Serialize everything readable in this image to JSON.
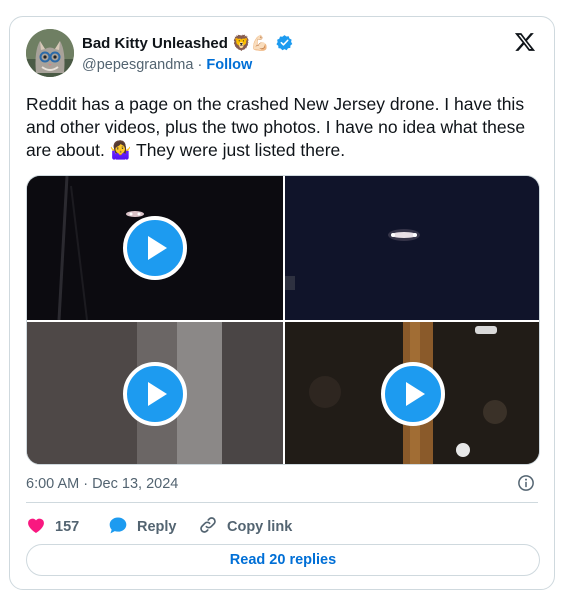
{
  "tweet": {
    "author_name": "Bad Kitty Unleashed",
    "author_emoji": "🦁💪🏻",
    "handle": "@pepesgrandma",
    "separator": " · ",
    "follow_label": "Follow",
    "text": "Reddit has a page on the crashed New Jersey drone. I have this and other videos, plus the two photos. I have no idea what these are about. 🤷‍♀️ They were just listed there.",
    "timestamp": "6:00 AM · Dec 13, 2024"
  },
  "actions": {
    "like_count": "157",
    "reply_label": "Reply",
    "copy_link_label": "Copy link"
  },
  "read_replies_label": "Read 20 replies",
  "media": [
    {
      "kind": "video"
    },
    {
      "kind": "video"
    },
    {
      "kind": "video"
    },
    {
      "kind": "video"
    }
  ],
  "colors": {
    "accent": "#1d9bf0",
    "link": "#006fd6",
    "like": "#f91880",
    "muted": "#536471",
    "border": "#cfd9de"
  },
  "icons": [
    "verified-badge-icon",
    "x-logo-icon",
    "play-icon",
    "info-icon",
    "heart-icon",
    "reply-bubble-icon",
    "link-icon"
  ]
}
